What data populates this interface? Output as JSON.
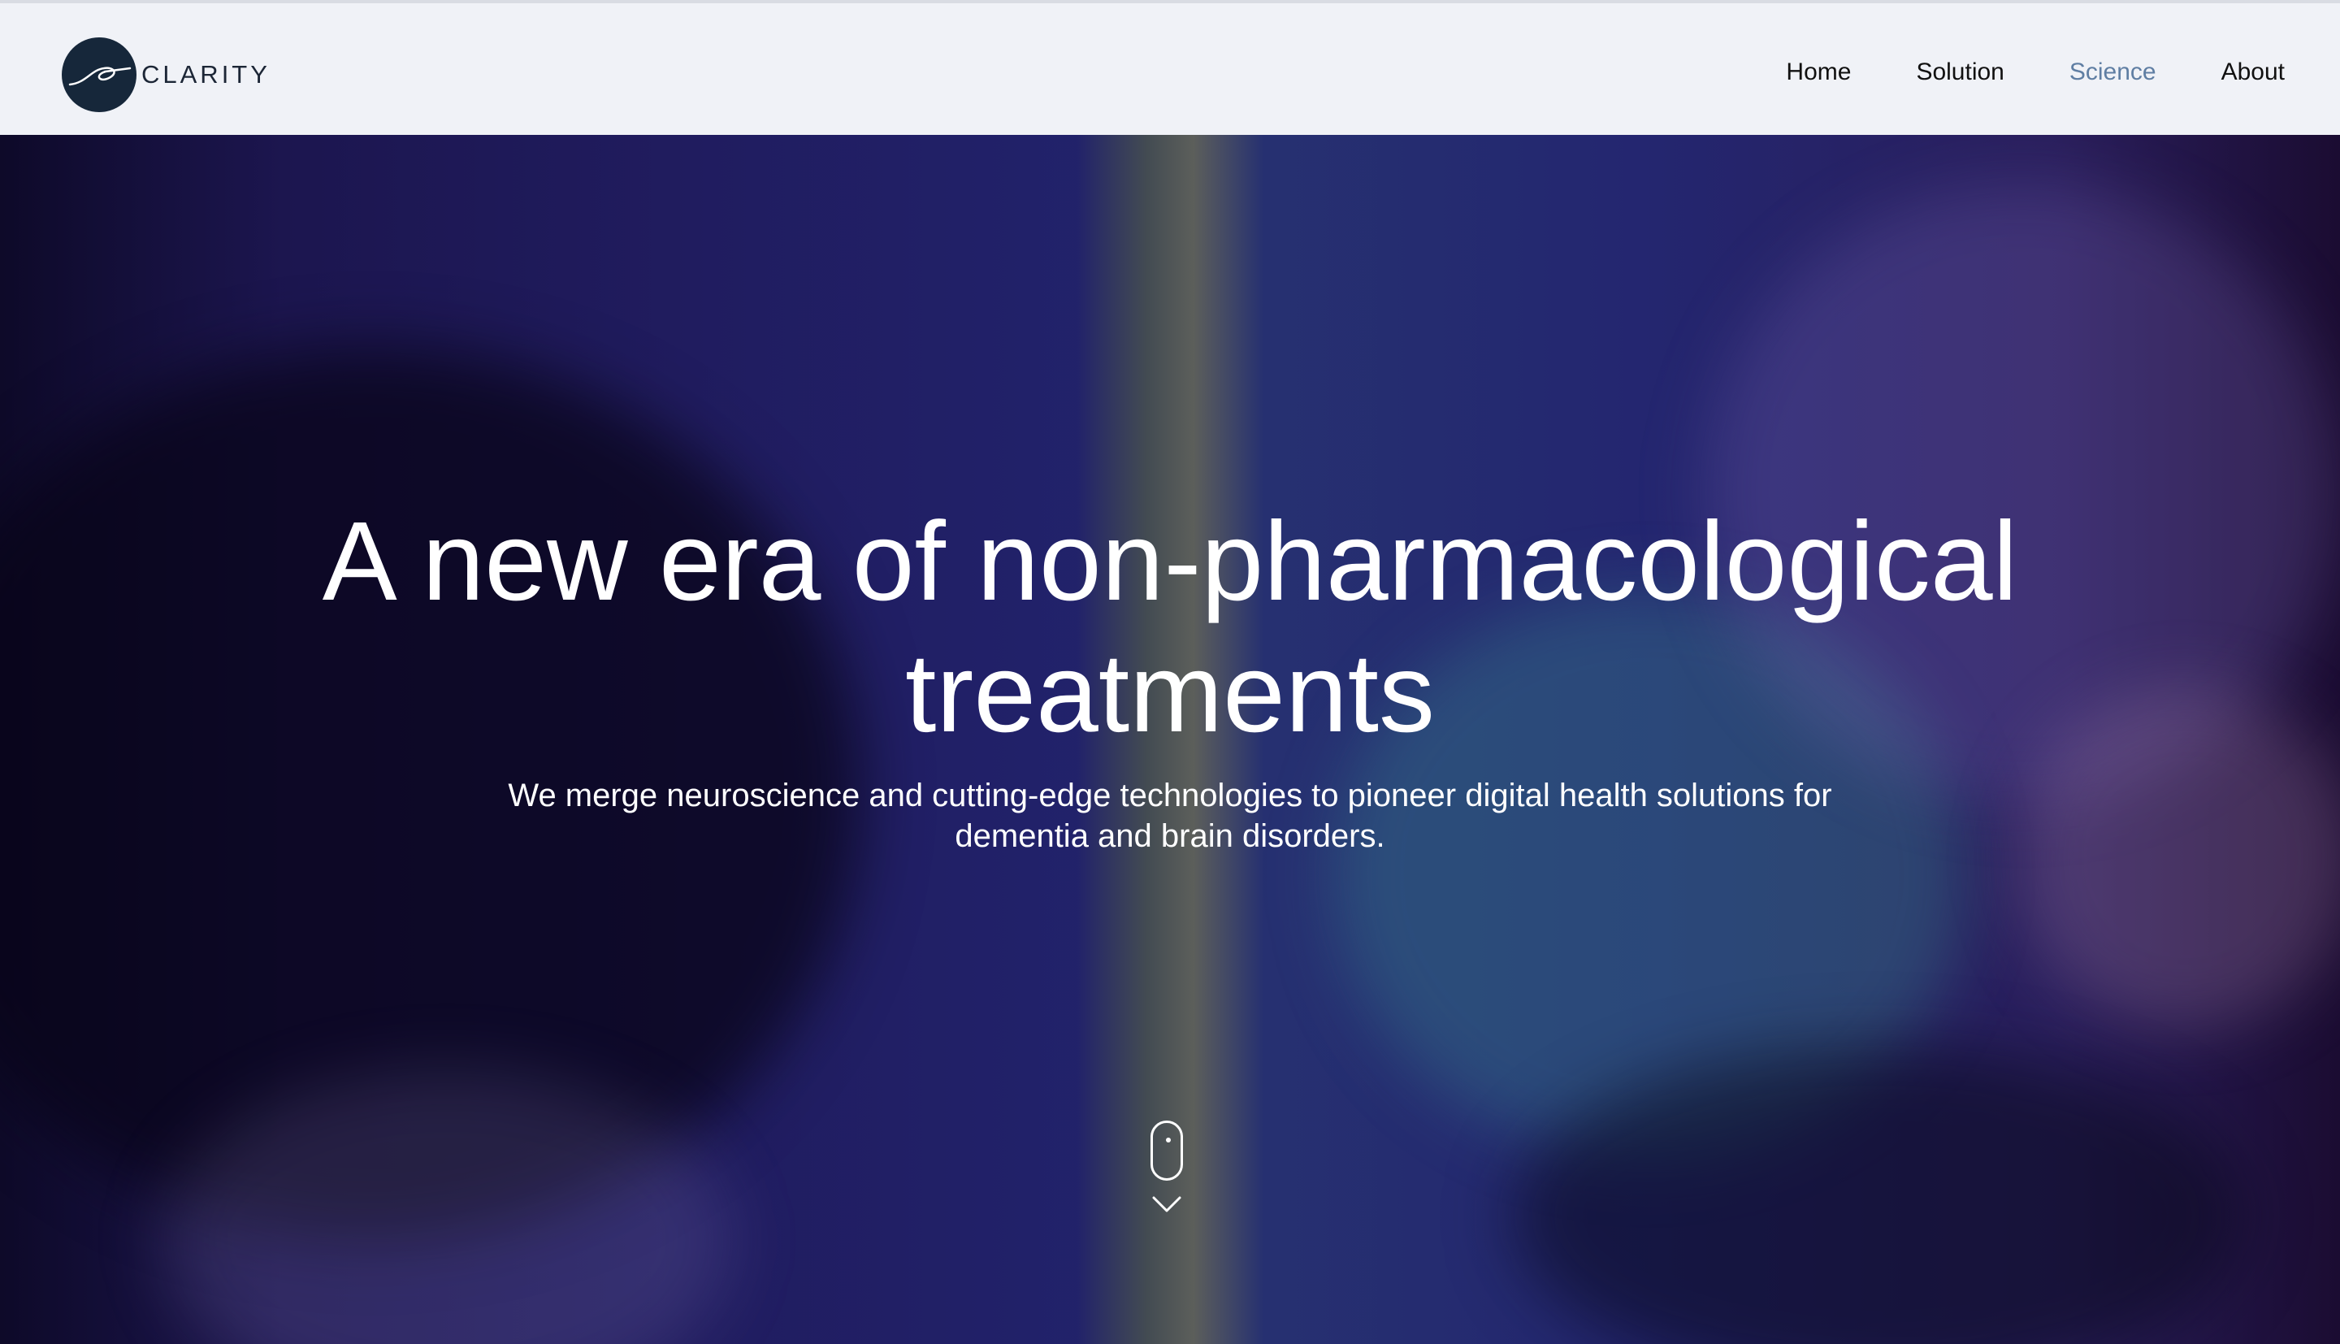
{
  "brand": {
    "name": "CLARITY",
    "logo_icon": "clarity-swirl-icon",
    "logo_color": "#16273a"
  },
  "nav": {
    "items": [
      {
        "label": "Home",
        "active": false
      },
      {
        "label": "Solution",
        "active": false
      },
      {
        "label": "Science",
        "active": true
      },
      {
        "label": "About",
        "active": false
      }
    ],
    "active_color": "#5f7ea3"
  },
  "hero": {
    "title": "A new era of non-pharmacological treatments",
    "subtitle": "We merge neuroscience and cutting-edge technologies to pioneer digital health solutions for dementia and brain disorders.",
    "scroll_icon": "mouse-scroll-icon",
    "scroll_chevron_icon": "chevron-down-icon"
  }
}
